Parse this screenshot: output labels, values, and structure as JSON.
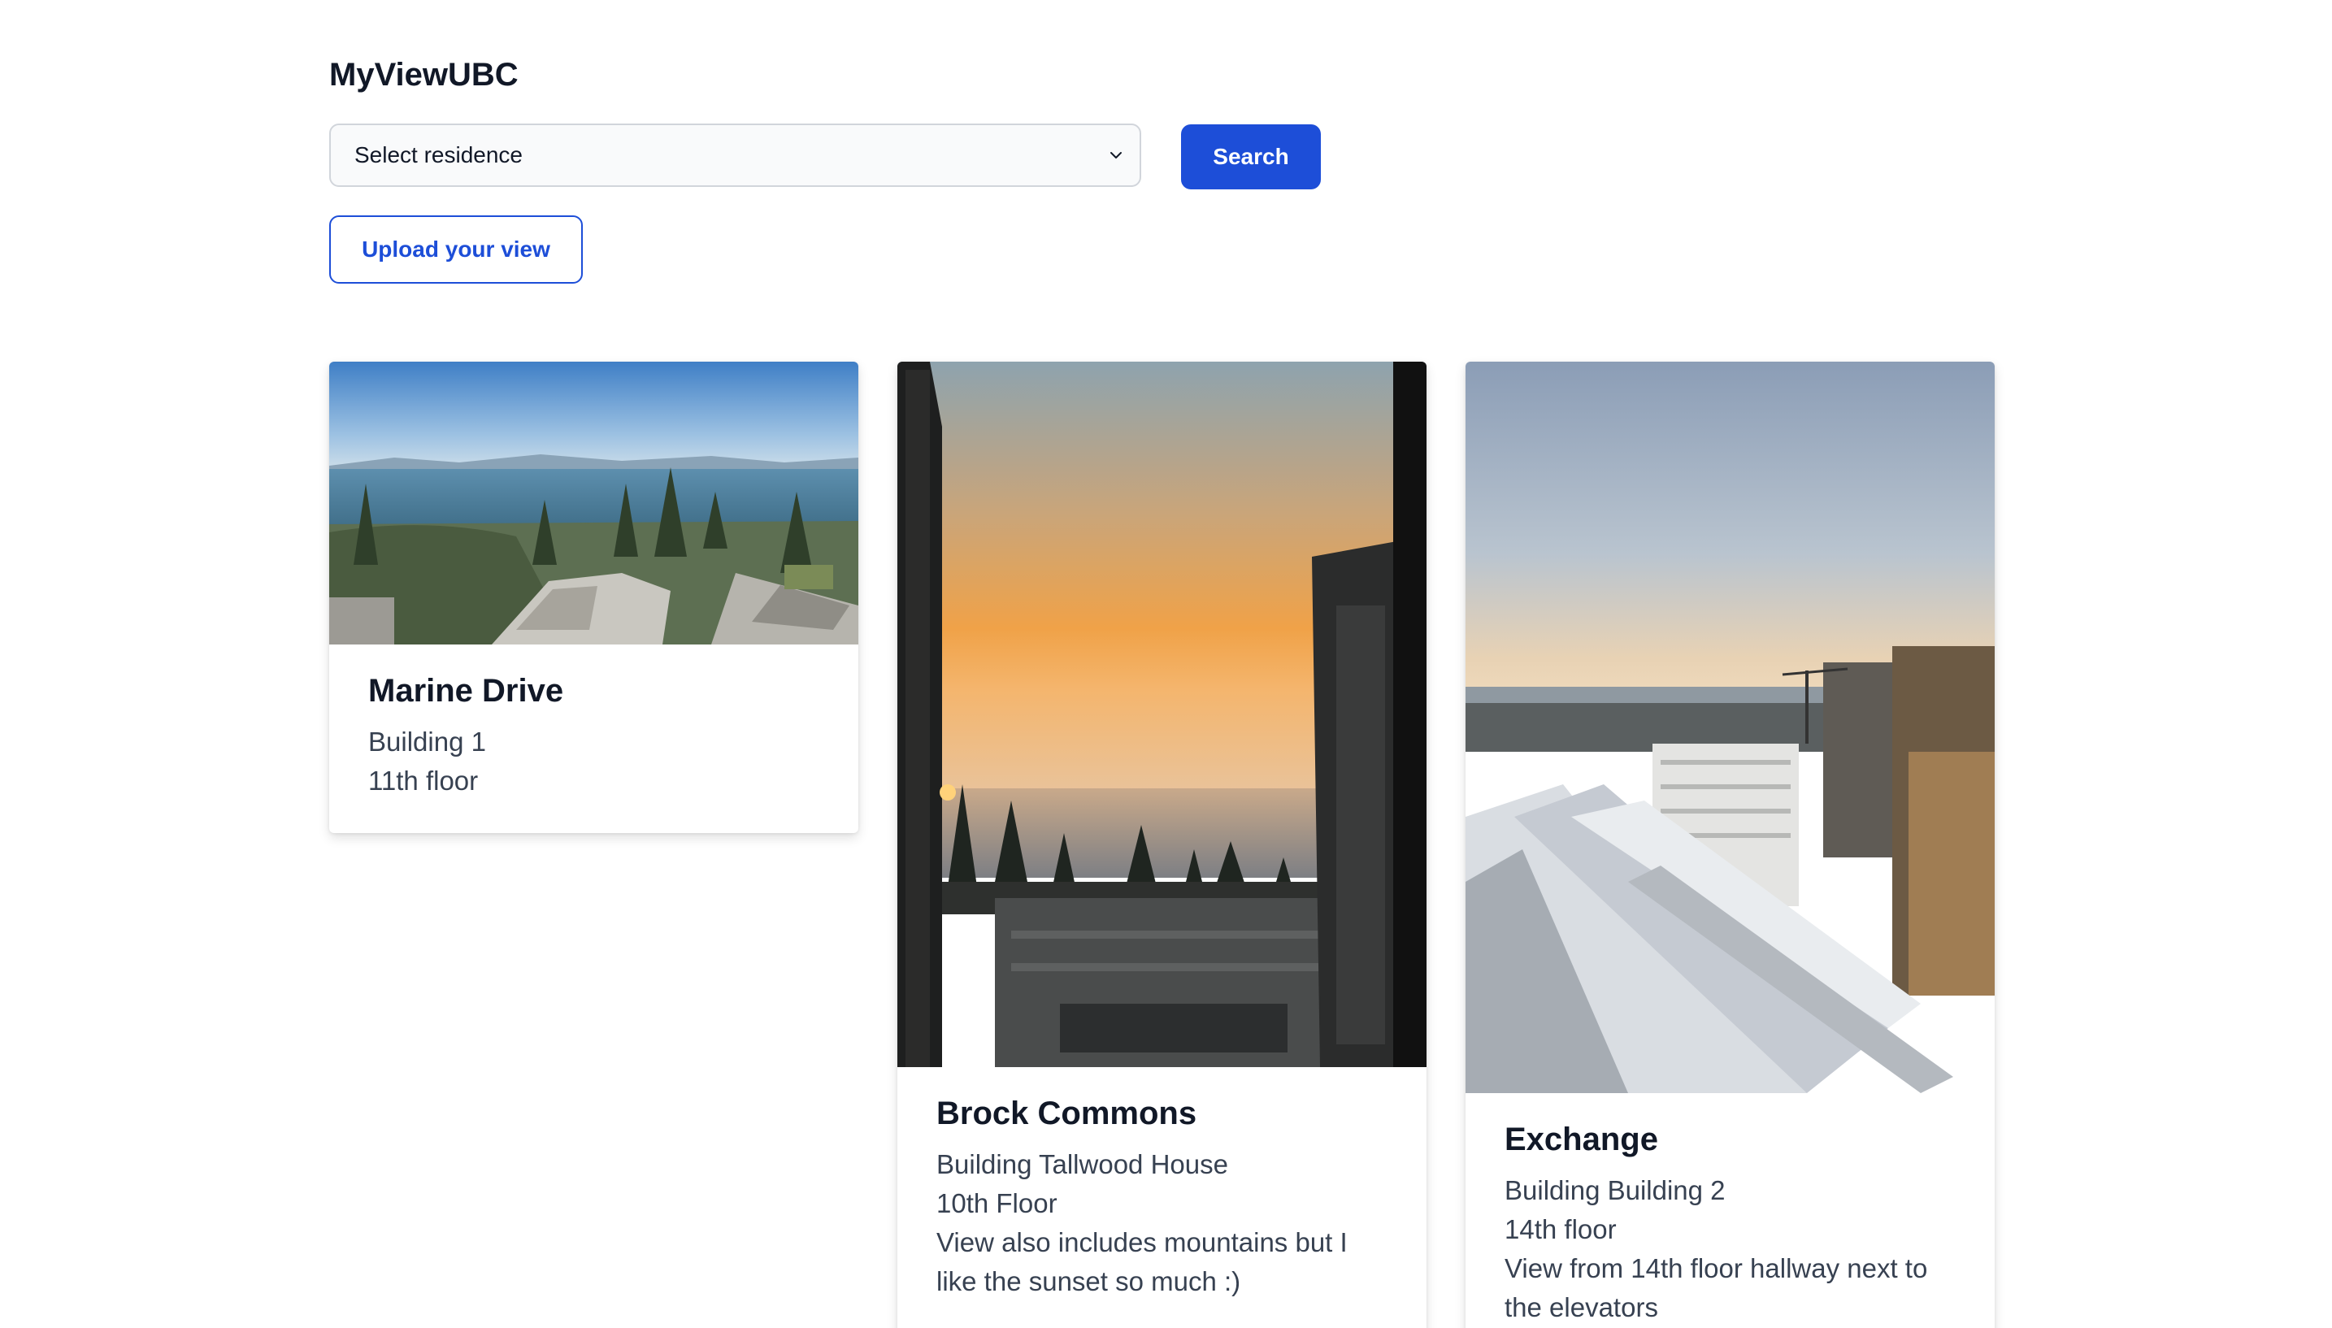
{
  "header": {
    "app_title": "MyViewUBC"
  },
  "search": {
    "residence_select_value": "Select residence",
    "search_label": "Search",
    "upload_label": "Upload your view"
  },
  "cards": [
    {
      "title": "Marine Drive",
      "building": "Building 1",
      "floor": "11th floor",
      "photo_icon": "ocean-view-photo"
    },
    {
      "title": "Brock Commons",
      "building": "Building Tallwood House",
      "floor": "10th Floor",
      "description_line1": "View also includes mountains but I",
      "description_line2": "like the sunset so much :)",
      "photo_icon": "sunset-view-photo"
    },
    {
      "title": "Exchange",
      "building": "Building Building 2",
      "floor": "14th floor",
      "description_line1": "View from 14th floor hallway next to",
      "description_line2": "the elevators",
      "photo_icon": "snowy-rooftop-view-photo"
    }
  ],
  "colors": {
    "primary": "#1d4ed8",
    "text": "#111827",
    "muted_text": "#374151",
    "select_bg": "#f9fafb",
    "select_border": "#d1d5db"
  }
}
